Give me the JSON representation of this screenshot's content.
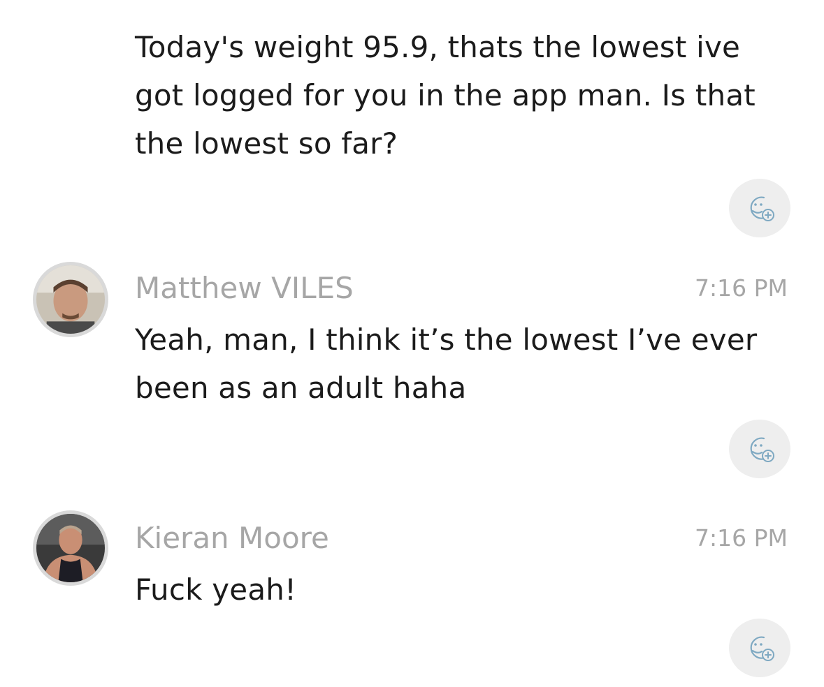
{
  "messages": [
    {
      "text": "Today's weight 95.9, thats the lowest ive\ngot logged for you in the app man. Is that\nthe lowest so far?"
    },
    {
      "sender": "Matthew VILES",
      "time": "7:16 PM",
      "text": "Yeah, man, I think it’s the lowest I’ve ever\nbeen as an adult haha"
    },
    {
      "sender": "Kieran Moore",
      "time": "7:16 PM",
      "text": "Fuck yeah!"
    }
  ],
  "icons": {
    "reaction": "add-reaction-icon",
    "avatar": "avatar"
  },
  "colors": {
    "text": "#1b1b1b",
    "meta": "#a6a6a6",
    "reaction_bg": "#eeeeee",
    "reaction_stroke": "#7fa9c2"
  }
}
